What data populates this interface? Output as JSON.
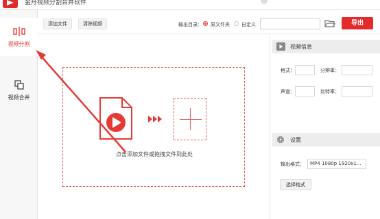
{
  "app": {
    "title": "金舟视频分割合并软件"
  },
  "sidebar": {
    "items": [
      {
        "label": "视频分割",
        "icon": "split-icon",
        "active": true
      },
      {
        "label": "视频合并",
        "icon": "merge-icon",
        "active": false
      }
    ]
  },
  "toolbar": {
    "add_file_label": "添加文件",
    "clear_label": "清除视频",
    "output_dir_label": "输出目录：",
    "radio_source_label": "原文件夹",
    "radio_custom_label": "自定义",
    "selected_option": "原文件夹",
    "path_value": "",
    "export_label": "导出"
  },
  "dropzone": {
    "hint": "点击添加文件或拖拽文件到此处"
  },
  "video_info": {
    "header": "视频信息",
    "format_label": "格式：",
    "format_value": "",
    "resolution_label": "分辨率：",
    "resolution_value": "",
    "channel_label": "声道：",
    "channel_value": "",
    "bitrate_label": "比特率：",
    "bitrate_value": ""
  },
  "settings": {
    "header": "设置",
    "output_format_label": "输出格式：",
    "output_format_value": "MP4 1080p 1920x1...",
    "choose_format_label": "选择格式"
  },
  "colors": {
    "accent": "#e32b2b",
    "dashed_border": "#e25b5b",
    "panel_header": "#ededed"
  }
}
